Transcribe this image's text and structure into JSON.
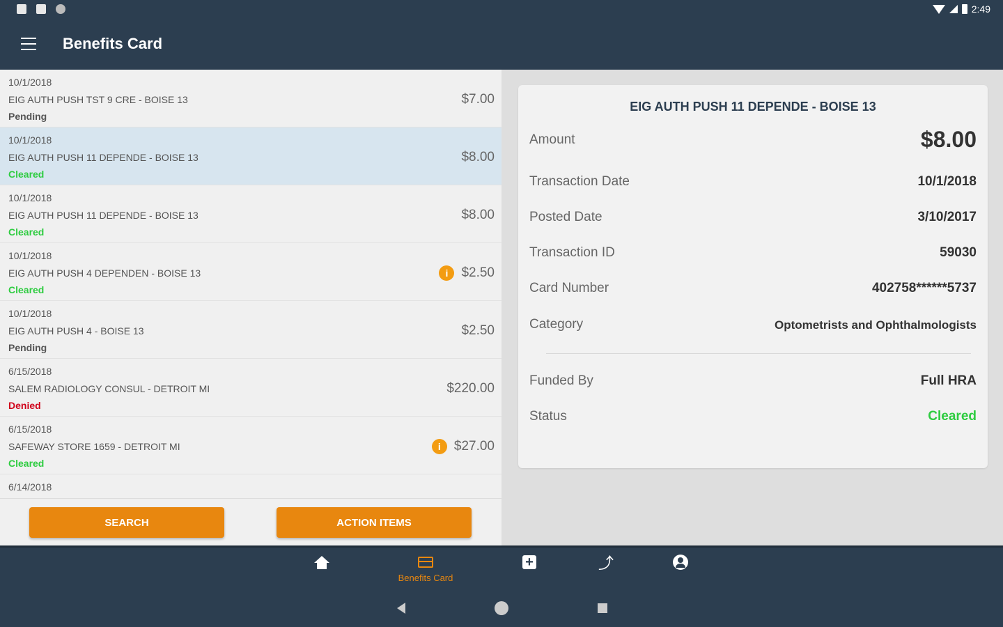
{
  "status_bar": {
    "time": "2:49"
  },
  "app_bar": {
    "title": "Benefits Card"
  },
  "transactions": [
    {
      "date": "10/1/2018",
      "merchant": "EIG AUTH PUSH TST 9  CRE - BOISE 13",
      "status": "Pending",
      "status_color": "#555555",
      "amount": "$7.00",
      "has_info": false,
      "selected": false
    },
    {
      "date": "10/1/2018",
      "merchant": "EIG AUTH PUSH 11 DEPENDE - BOISE 13",
      "status": "Cleared",
      "status_color": "#2ecc40",
      "amount": "$8.00",
      "has_info": false,
      "selected": true
    },
    {
      "date": "10/1/2018",
      "merchant": "EIG AUTH PUSH 11 DEPENDE - BOISE 13",
      "status": "Cleared",
      "status_color": "#2ecc40",
      "amount": "$8.00",
      "has_info": false,
      "selected": false
    },
    {
      "date": "10/1/2018",
      "merchant": "EIG AUTH PUSH 4 DEPENDEN - BOISE 13",
      "status": "Cleared",
      "status_color": "#2ecc40",
      "amount": "$2.50",
      "has_info": true,
      "selected": false
    },
    {
      "date": "10/1/2018",
      "merchant": "EIG AUTH PUSH 4 - BOISE 13",
      "status": "Pending",
      "status_color": "#555555",
      "amount": "$2.50",
      "has_info": false,
      "selected": false
    },
    {
      "date": "6/15/2018",
      "merchant": "SALEM RADIOLOGY CONSUL - DETROIT MI",
      "status": "Denied",
      "status_color": "#d0021b",
      "amount": "$220.00",
      "has_info": false,
      "selected": false
    },
    {
      "date": "6/15/2018",
      "merchant": "SAFEWAY  STORE  1659 - DETROIT MI",
      "status": "Cleared",
      "status_color": "#2ecc40",
      "amount": "$27.00",
      "has_info": true,
      "selected": false
    },
    {
      "date": "6/14/2018",
      "merchant": "",
      "status": "",
      "status_color": "#555555",
      "amount": "",
      "has_info": false,
      "selected": false
    }
  ],
  "info_glyph": "i",
  "buttons": {
    "search": "SEARCH",
    "action_items": "ACTION ITEMS"
  },
  "detail": {
    "title": "EIG AUTH PUSH 11 DEPENDE - BOISE 13",
    "amount_label": "Amount",
    "amount_value": "$8.00",
    "transaction_date_label": "Transaction Date",
    "transaction_date_value": "10/1/2018",
    "posted_date_label": "Posted Date",
    "posted_date_value": "3/10/2017",
    "transaction_id_label": "Transaction ID",
    "transaction_id_value": "59030",
    "card_number_label": "Card Number",
    "card_number_value": "402758******5737",
    "category_label": "Category",
    "category_value": "Optometrists and Ophthalmologists",
    "funded_by_label": "Funded By",
    "funded_by_value": "Full HRA",
    "status_label": "Status",
    "status_value": "Cleared"
  },
  "bottom_nav": {
    "items": [
      {
        "name": "home",
        "label": ""
      },
      {
        "name": "benefits-card",
        "label": "Benefits Card"
      },
      {
        "name": "add",
        "label": ""
      },
      {
        "name": "trends",
        "label": ""
      },
      {
        "name": "account",
        "label": ""
      }
    ],
    "plus_glyph": "+",
    "trend_glyph": "⤴"
  },
  "colors": {
    "accent": "#e8870f",
    "header": "#2c3e50",
    "cleared": "#2ecc40",
    "denied": "#d0021b",
    "selected_row": "#d7e5ef"
  }
}
